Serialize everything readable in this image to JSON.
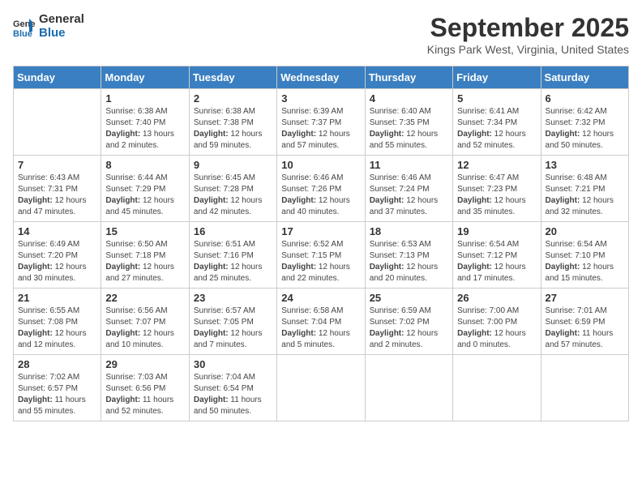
{
  "header": {
    "logo_general": "General",
    "logo_blue": "Blue",
    "month": "September 2025",
    "location": "Kings Park West, Virginia, United States"
  },
  "weekdays": [
    "Sunday",
    "Monday",
    "Tuesday",
    "Wednesday",
    "Thursday",
    "Friday",
    "Saturday"
  ],
  "weeks": [
    [
      {
        "day": "",
        "info": ""
      },
      {
        "day": "1",
        "info": "Sunrise: 6:38 AM\nSunset: 7:40 PM\nDaylight: 13 hours\nand 2 minutes."
      },
      {
        "day": "2",
        "info": "Sunrise: 6:38 AM\nSunset: 7:38 PM\nDaylight: 12 hours\nand 59 minutes."
      },
      {
        "day": "3",
        "info": "Sunrise: 6:39 AM\nSunset: 7:37 PM\nDaylight: 12 hours\nand 57 minutes."
      },
      {
        "day": "4",
        "info": "Sunrise: 6:40 AM\nSunset: 7:35 PM\nDaylight: 12 hours\nand 55 minutes."
      },
      {
        "day": "5",
        "info": "Sunrise: 6:41 AM\nSunset: 7:34 PM\nDaylight: 12 hours\nand 52 minutes."
      },
      {
        "day": "6",
        "info": "Sunrise: 6:42 AM\nSunset: 7:32 PM\nDaylight: 12 hours\nand 50 minutes."
      }
    ],
    [
      {
        "day": "7",
        "info": "Sunrise: 6:43 AM\nSunset: 7:31 PM\nDaylight: 12 hours\nand 47 minutes."
      },
      {
        "day": "8",
        "info": "Sunrise: 6:44 AM\nSunset: 7:29 PM\nDaylight: 12 hours\nand 45 minutes."
      },
      {
        "day": "9",
        "info": "Sunrise: 6:45 AM\nSunset: 7:28 PM\nDaylight: 12 hours\nand 42 minutes."
      },
      {
        "day": "10",
        "info": "Sunrise: 6:46 AM\nSunset: 7:26 PM\nDaylight: 12 hours\nand 40 minutes."
      },
      {
        "day": "11",
        "info": "Sunrise: 6:46 AM\nSunset: 7:24 PM\nDaylight: 12 hours\nand 37 minutes."
      },
      {
        "day": "12",
        "info": "Sunrise: 6:47 AM\nSunset: 7:23 PM\nDaylight: 12 hours\nand 35 minutes."
      },
      {
        "day": "13",
        "info": "Sunrise: 6:48 AM\nSunset: 7:21 PM\nDaylight: 12 hours\nand 32 minutes."
      }
    ],
    [
      {
        "day": "14",
        "info": "Sunrise: 6:49 AM\nSunset: 7:20 PM\nDaylight: 12 hours\nand 30 minutes."
      },
      {
        "day": "15",
        "info": "Sunrise: 6:50 AM\nSunset: 7:18 PM\nDaylight: 12 hours\nand 27 minutes."
      },
      {
        "day": "16",
        "info": "Sunrise: 6:51 AM\nSunset: 7:16 PM\nDaylight: 12 hours\nand 25 minutes."
      },
      {
        "day": "17",
        "info": "Sunrise: 6:52 AM\nSunset: 7:15 PM\nDaylight: 12 hours\nand 22 minutes."
      },
      {
        "day": "18",
        "info": "Sunrise: 6:53 AM\nSunset: 7:13 PM\nDaylight: 12 hours\nand 20 minutes."
      },
      {
        "day": "19",
        "info": "Sunrise: 6:54 AM\nSunset: 7:12 PM\nDaylight: 12 hours\nand 17 minutes."
      },
      {
        "day": "20",
        "info": "Sunrise: 6:54 AM\nSunset: 7:10 PM\nDaylight: 12 hours\nand 15 minutes."
      }
    ],
    [
      {
        "day": "21",
        "info": "Sunrise: 6:55 AM\nSunset: 7:08 PM\nDaylight: 12 hours\nand 12 minutes."
      },
      {
        "day": "22",
        "info": "Sunrise: 6:56 AM\nSunset: 7:07 PM\nDaylight: 12 hours\nand 10 minutes."
      },
      {
        "day": "23",
        "info": "Sunrise: 6:57 AM\nSunset: 7:05 PM\nDaylight: 12 hours\nand 7 minutes."
      },
      {
        "day": "24",
        "info": "Sunrise: 6:58 AM\nSunset: 7:04 PM\nDaylight: 12 hours\nand 5 minutes."
      },
      {
        "day": "25",
        "info": "Sunrise: 6:59 AM\nSunset: 7:02 PM\nDaylight: 12 hours\nand 2 minutes."
      },
      {
        "day": "26",
        "info": "Sunrise: 7:00 AM\nSunset: 7:00 PM\nDaylight: 12 hours\nand 0 minutes."
      },
      {
        "day": "27",
        "info": "Sunrise: 7:01 AM\nSunset: 6:59 PM\nDaylight: 11 hours\nand 57 minutes."
      }
    ],
    [
      {
        "day": "28",
        "info": "Sunrise: 7:02 AM\nSunset: 6:57 PM\nDaylight: 11 hours\nand 55 minutes."
      },
      {
        "day": "29",
        "info": "Sunrise: 7:03 AM\nSunset: 6:56 PM\nDaylight: 11 hours\nand 52 minutes."
      },
      {
        "day": "30",
        "info": "Sunrise: 7:04 AM\nSunset: 6:54 PM\nDaylight: 11 hours\nand 50 minutes."
      },
      {
        "day": "",
        "info": ""
      },
      {
        "day": "",
        "info": ""
      },
      {
        "day": "",
        "info": ""
      },
      {
        "day": "",
        "info": ""
      }
    ]
  ]
}
